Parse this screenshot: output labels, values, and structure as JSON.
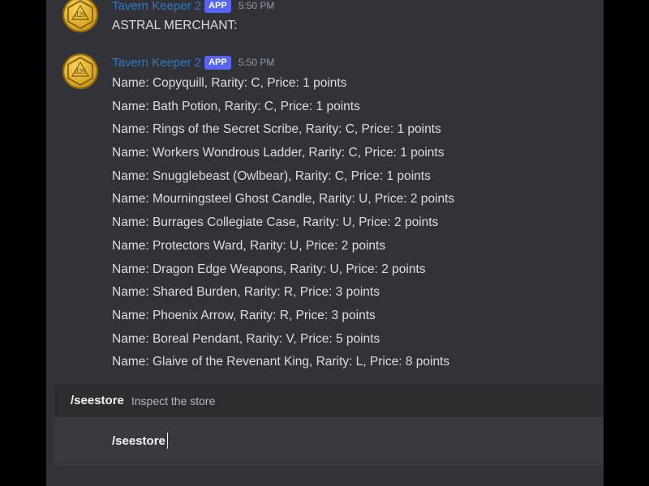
{
  "messages": [
    {
      "author": "Tavern Keeper 2",
      "badge": "APP",
      "time": "5:50 PM",
      "lines": [
        "ASTRAL MERCHANT:"
      ]
    },
    {
      "author": "Tavern Keeper 2",
      "badge": "APP",
      "time": "5:50 PM",
      "lines": [
        "Name: Copyquill, Rarity: C, Price: 1 points",
        "Name: Bath Potion, Rarity: C, Price: 1 points",
        "Name: Rings of the Secret Scribe, Rarity: C, Price: 1 points",
        "Name: Workers Wondrous Ladder, Rarity: C, Price: 1 points",
        "Name: Snugglebeast (Owlbear), Rarity: C, Price: 1 points",
        "Name: Mourningsteel Ghost Candle, Rarity: U, Price: 2 points",
        "Name: Burrages Collegiate Case, Rarity: U, Price: 2 points",
        "Name: Protectors Ward, Rarity: U, Price: 2 points",
        "Name: Dragon Edge Weapons, Rarity: U, Price: 2 points",
        "Name: Shared Burden, Rarity: R, Price: 3 points",
        "Name: Phoenix Arrow, Rarity: R, Price: 3 points",
        "Name: Boreal Pendant, Rarity: V, Price: 5 points",
        "Name: Glaive of the Revenant King, Rarity: L, Price: 8 points"
      ]
    }
  ],
  "avatar_text": "d20",
  "autocomplete": {
    "command": "/seestore",
    "description": "Inspect the store"
  },
  "composer": {
    "value": "/seestore"
  },
  "colors": {
    "username": "#2f79c2",
    "badge": "#5865f2",
    "background": "#313338"
  }
}
